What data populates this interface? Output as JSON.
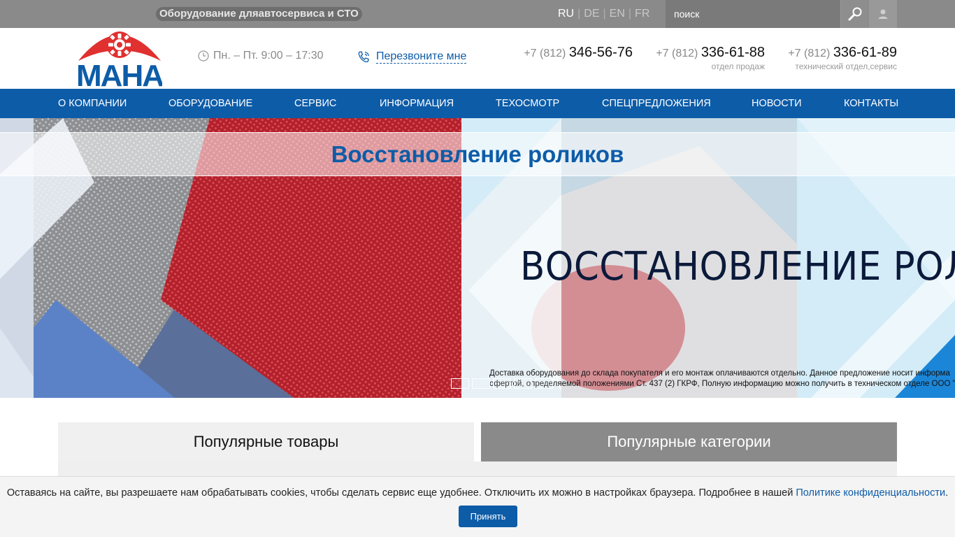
{
  "topbar": {
    "tagline": "Оборудование дляавтосервиса и СТО",
    "languages": [
      {
        "code": "RU",
        "active": true
      },
      {
        "code": "DE",
        "active": false
      },
      {
        "code": "EN",
        "active": false
      },
      {
        "code": "FR",
        "active": false
      }
    ],
    "search_placeholder": "поиск",
    "search_icon": "search-icon",
    "user_icon": "user-icon"
  },
  "header": {
    "logo_text": "MAHA",
    "hours": "Пн. – Пт. 9:00 – 17:30",
    "callback_label": "Перезвоните мне",
    "phones": [
      {
        "code": "+7 (812)",
        "number": "346-56-76",
        "caption": ""
      },
      {
        "code": "+7 (812)",
        "number": "336-61-88",
        "caption": "отдел продаж"
      },
      {
        "code": "+7 (812)",
        "number": "336-61-89",
        "caption": "технический отдел,сервис"
      }
    ]
  },
  "nav": {
    "items": [
      {
        "label": "О компании"
      },
      {
        "label": "Оборудование"
      },
      {
        "label": "Сервис"
      },
      {
        "label": "Информация"
      },
      {
        "label": "Техосмотр"
      },
      {
        "label": "Спецпредложения"
      },
      {
        "label": "Новости"
      },
      {
        "label": "Контакты"
      }
    ]
  },
  "banner": {
    "title": "Восстановление роликов",
    "big_text": "ВОССТАНОВЛЕНИЕ РОЛИ",
    "note_line1": "Доставка оборудования до склада покупателя и его монтаж оплачиваются отдельно. Данное предложение носит информа",
    "note_line2": "офертой, определяемой положениями Ст. 437 (2) ГКРФ, Полную информацию  можно получить в техническом отделе ООО \"",
    "slides_count": 5,
    "active_slide": 1,
    "colors": {
      "accent_blue": "#0d5ca8",
      "roller_red": "#b8262f"
    }
  },
  "tabs": {
    "popular_products": "Популярные товары",
    "popular_categories": "Популярные категории"
  },
  "cookie": {
    "text": "Оставаясь на сайте, вы разрешаете нам обрабатывать cookies, чтобы сделать сервис еще удобнее. Отключить их можно в настройках браузера. Подробнее в нашей ",
    "link": "Политике конфиденциальности",
    "after": ".",
    "accept": "Принять"
  }
}
